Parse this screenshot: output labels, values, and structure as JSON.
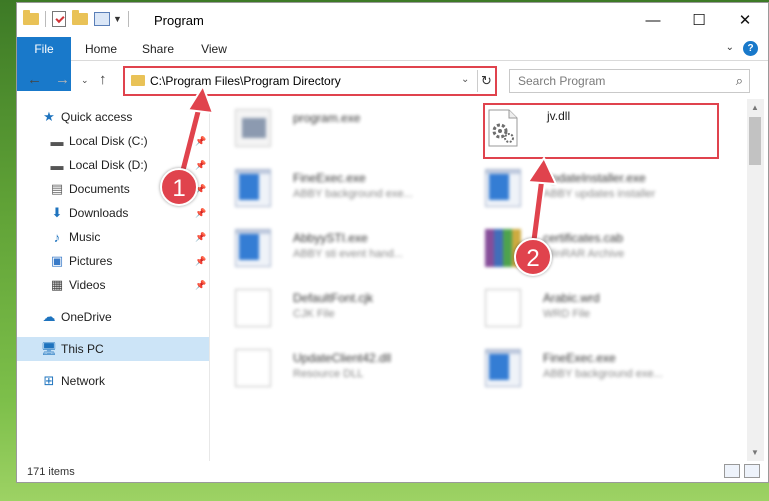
{
  "window": {
    "title": "Program",
    "controls": {
      "minimize": "—",
      "maximize": "☐",
      "close": "✕"
    }
  },
  "ribbon": {
    "tabs": [
      {
        "label": "File"
      },
      {
        "label": "Home"
      },
      {
        "label": "Share"
      },
      {
        "label": "View"
      }
    ]
  },
  "address": {
    "path": "C:\\Program Files\\Program Directory",
    "search_placeholder": "Search Program"
  },
  "nav": {
    "items": [
      {
        "label": "Quick access",
        "icon": "star-icon"
      },
      {
        "label": "Local Disk (C:)",
        "icon": "drive-icon",
        "pinned": true
      },
      {
        "label": "Local Disk (D:)",
        "icon": "drive-icon",
        "pinned": true
      },
      {
        "label": "Documents",
        "icon": "document-icon",
        "pinned": true
      },
      {
        "label": "Downloads",
        "icon": "download-icon",
        "pinned": true
      },
      {
        "label": "Music",
        "icon": "music-icon",
        "pinned": true
      },
      {
        "label": "Pictures",
        "icon": "pictures-icon",
        "pinned": true
      },
      {
        "label": "Videos",
        "icon": "video-icon",
        "pinned": true
      },
      {
        "label": "OneDrive",
        "icon": "cloud-icon"
      },
      {
        "label": "This PC",
        "icon": "computer-icon",
        "selected": true
      },
      {
        "label": "Network",
        "icon": "network-icon"
      }
    ]
  },
  "files": [
    {
      "name": "program.exe",
      "desc": "",
      "icon": "program-icon"
    },
    {
      "name": "jv.dll",
      "desc": "",
      "icon": "dll-gear-icon"
    },
    {
      "name": "FineExec.exe",
      "desc": "ABBY background exe...",
      "icon": "exe-icon"
    },
    {
      "name": "UpdateInstaller.exe",
      "desc": "ABBY updates installer",
      "icon": "exe-icon"
    },
    {
      "name": "AbbyySTI.exe",
      "desc": "ABBY sti event hand...",
      "icon": "exe-icon"
    },
    {
      "name": "certificates.cab",
      "desc": "WinRAR Archive",
      "icon": "archive-icon"
    },
    {
      "name": "DefaultFont.cjk",
      "desc": "CJK File",
      "icon": "file-icon"
    },
    {
      "name": "Arabic.wrd",
      "desc": "WRD File",
      "icon": "file-icon"
    },
    {
      "name": "UpdateClient42.dll",
      "desc": "Resource DLL",
      "icon": "dll-gear-icon"
    },
    {
      "name": "FineExec.exe",
      "desc": "ABBY background exe...",
      "icon": "exe-icon"
    }
  ],
  "status": {
    "item_count": "171 items"
  },
  "annotations": {
    "step1": "1",
    "step2": "2",
    "color": "#e0434d"
  }
}
